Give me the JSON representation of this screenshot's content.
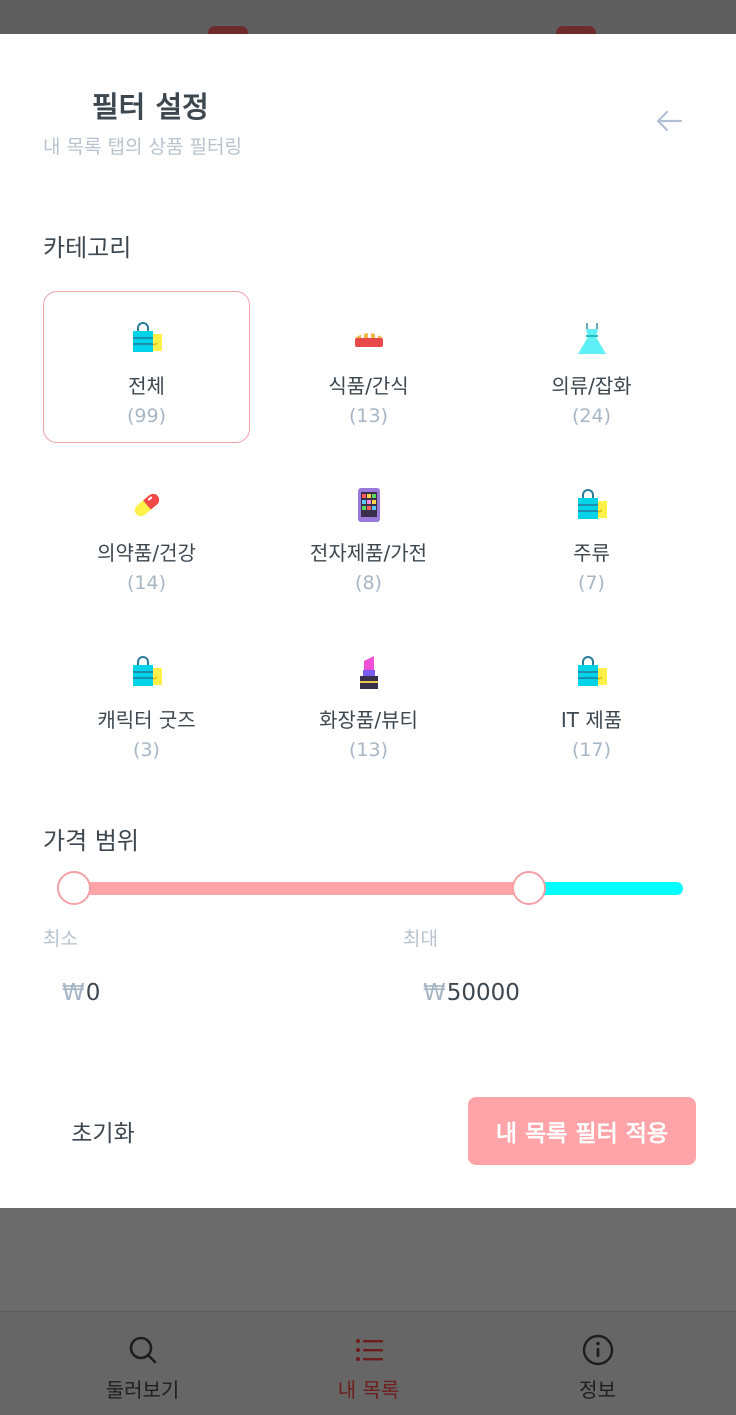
{
  "header": {
    "title": "필터 설정",
    "subtitle": "내 목록 탭의 상품 필터링"
  },
  "category_section": {
    "title": "카테고리",
    "items": [
      {
        "label": "전체",
        "count": "(99)",
        "icon": "shopping-bag-icon",
        "selected": true
      },
      {
        "label": "식품/간식",
        "count": "(13)",
        "icon": "bread-icon"
      },
      {
        "label": "의류/잡화",
        "count": "(24)",
        "icon": "dress-icon"
      },
      {
        "label": "의약품/건강",
        "count": "(14)",
        "icon": "pill-icon"
      },
      {
        "label": "전자제품/가전",
        "count": "(8)",
        "icon": "tablet-icon"
      },
      {
        "label": "주류",
        "count": "(7)",
        "icon": "shopping-bag-icon"
      },
      {
        "label": "캐릭터 굿즈",
        "count": "(3)",
        "icon": "shopping-bag-icon"
      },
      {
        "label": "화장품/뷰티",
        "count": "(13)",
        "icon": "lipstick-icon"
      },
      {
        "label": "IT 제품",
        "count": "(17)",
        "icon": "shopping-bag-icon"
      }
    ]
  },
  "price_section": {
    "title": "가격 범위",
    "slider_min_fraction": 0,
    "slider_max_fraction": 0.75,
    "min_label": "최소",
    "max_label": "최대",
    "currency": "₩",
    "min_value": "0",
    "max_value": "50000"
  },
  "actions": {
    "reset_label": "초기화",
    "apply_label": "내 목록 필터 적용"
  },
  "tabbar": {
    "items": [
      {
        "label": "둘러보기",
        "icon": "search-icon"
      },
      {
        "label": "내 목록",
        "icon": "list-icon",
        "active": true
      },
      {
        "label": "정보",
        "icon": "info-icon"
      }
    ]
  },
  "colors": {
    "accent": "#fea4a8",
    "slider_rest": "#00ffff",
    "text_primary": "#3d4750",
    "text_muted": "#a7b6c6"
  }
}
